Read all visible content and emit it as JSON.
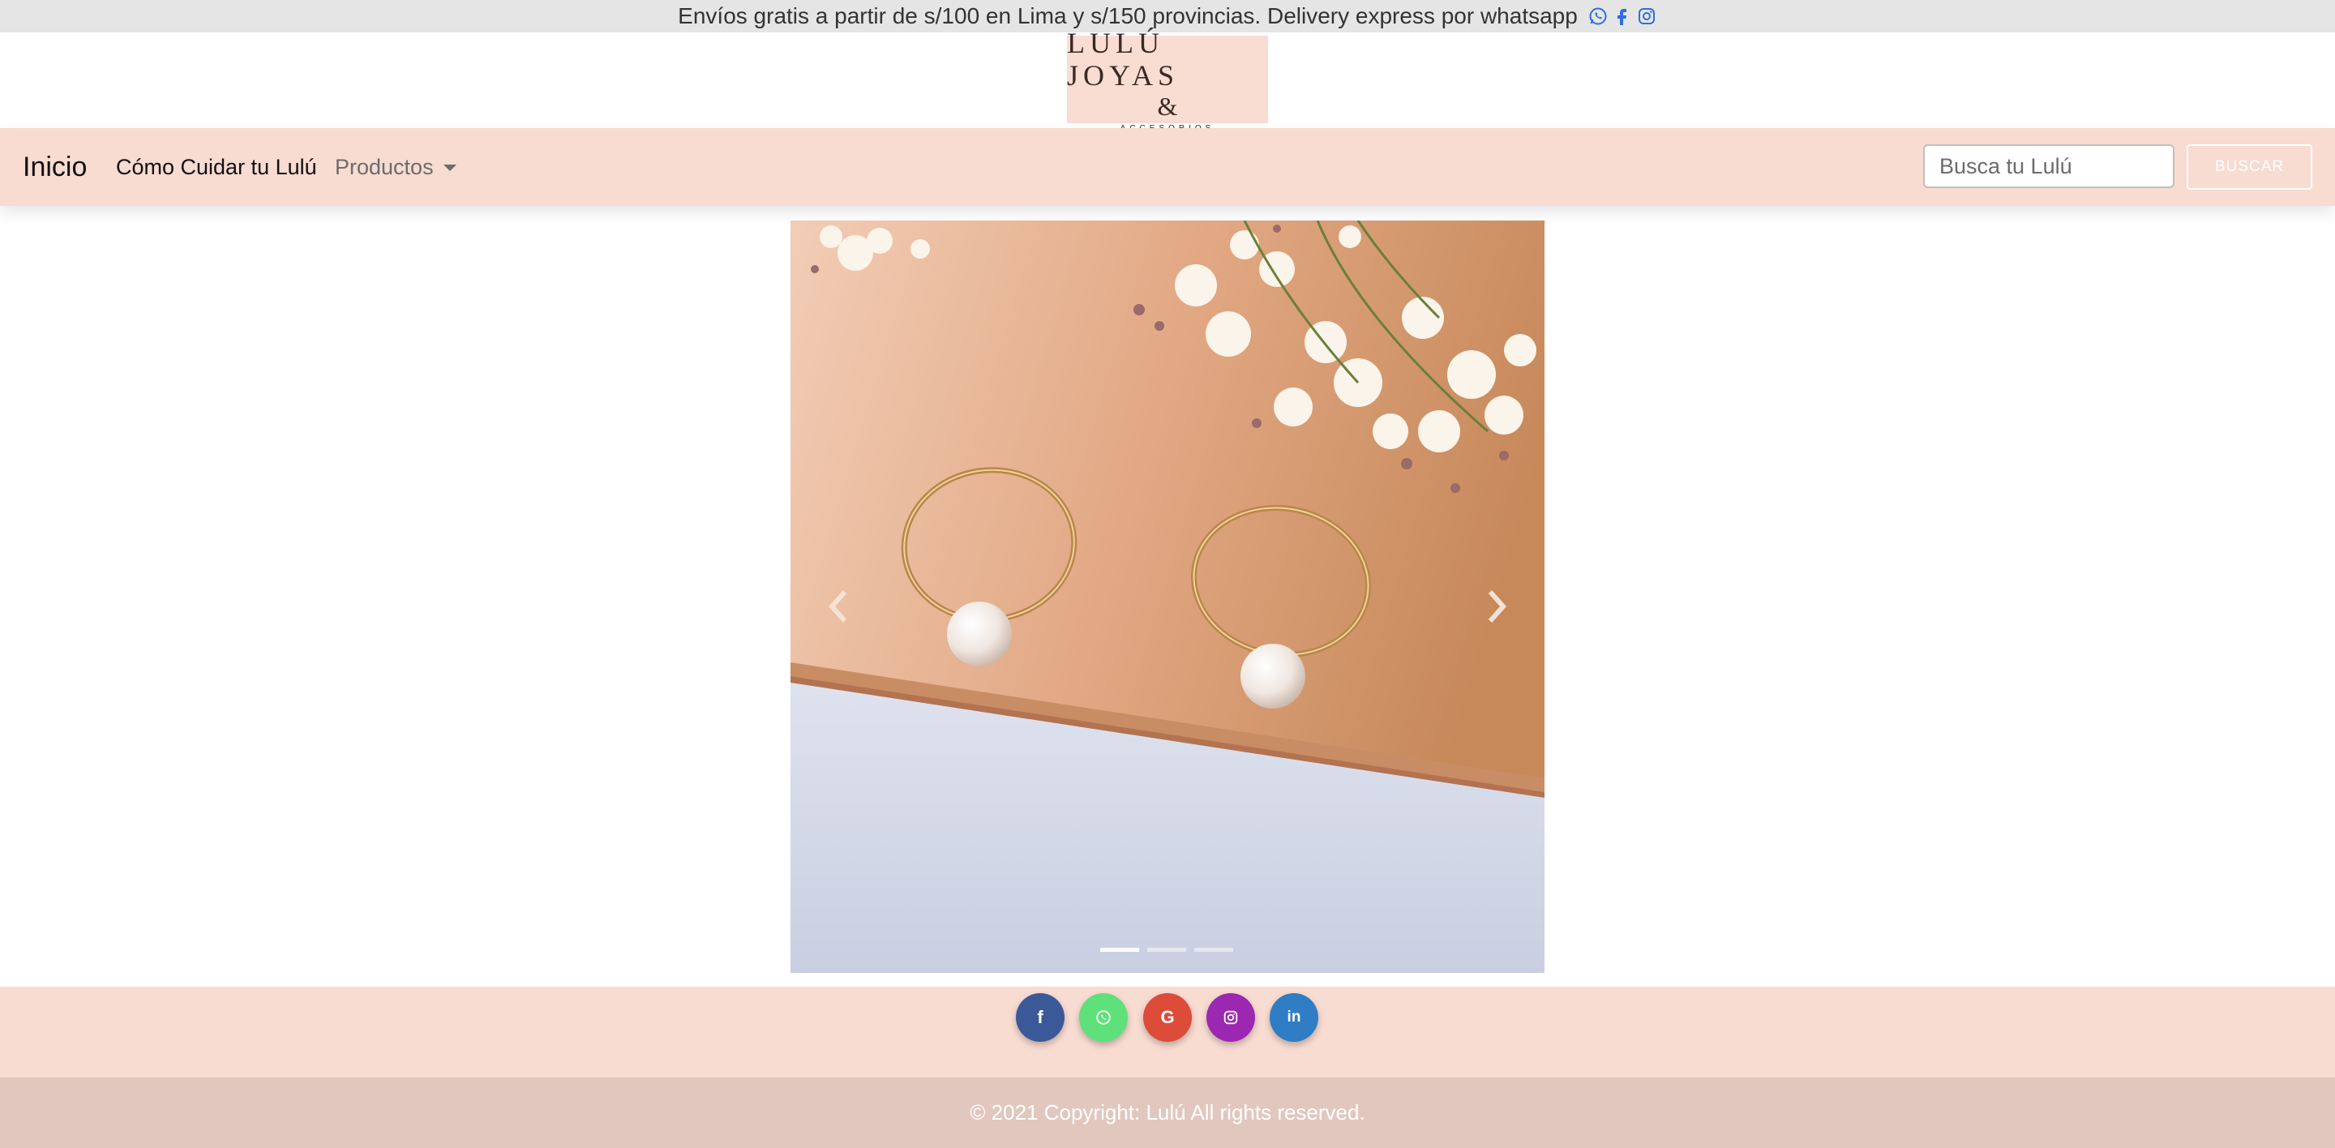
{
  "topbar": {
    "text": "Envíos gratis a partir de s/100 en Lima y s/150 provincias. Delivery express por whatsapp",
    "icons": [
      "whatsapp-icon",
      "facebook-icon",
      "instagram-icon"
    ]
  },
  "logo": {
    "line1": "LULÚ JOYAS",
    "line2": "&",
    "line3": "ACCESORIOS"
  },
  "navbar": {
    "brand": "Inicio",
    "links": [
      "Cómo Cuidar tu Lulú",
      "Productos"
    ],
    "search_placeholder": "Busca tu Lulú",
    "search_button": "BUSCAR"
  },
  "carousel": {
    "slide_count": 3,
    "active_index": 0,
    "prev_icon": "chevron-left-icon",
    "next_icon": "chevron-right-icon"
  },
  "footer": {
    "social": [
      {
        "name": "facebook",
        "color": "#3b5998",
        "glyph": "f"
      },
      {
        "name": "whatsapp",
        "color": "#5ee17a",
        "glyph": ""
      },
      {
        "name": "google",
        "color": "#dd4b39",
        "glyph": "G"
      },
      {
        "name": "instagram",
        "color": "#9c27b0",
        "glyph": ""
      },
      {
        "name": "linkedin",
        "color": "#2f7dc5",
        "glyph": "in"
      }
    ],
    "copyright": "© 2021 Copyright: Lulú All rights reserved."
  },
  "colors": {
    "topbar_bg": "#e5e5e5",
    "navbar_bg": "#f8dbd1",
    "footer_bg": "#f8dbd1",
    "copyright_bg": "#e2c7bf",
    "icon_blue": "#2f6de0"
  }
}
